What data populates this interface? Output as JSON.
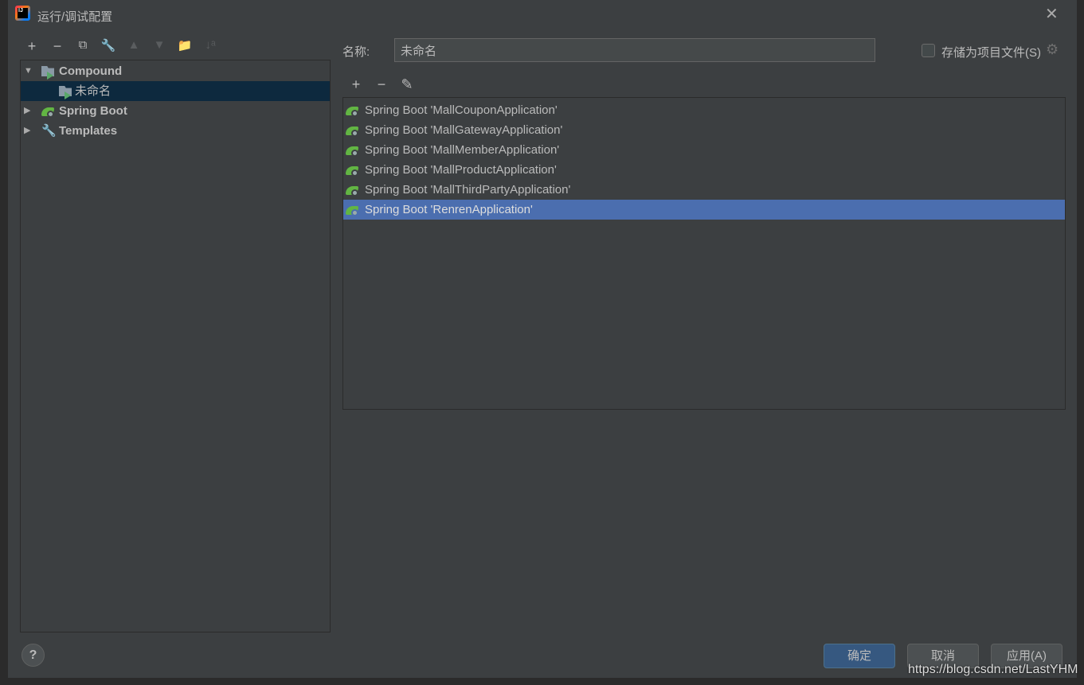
{
  "window": {
    "title": "运行/调试配置",
    "close_icon": "close-icon"
  },
  "left_toolbar": [
    {
      "name": "add-icon",
      "glyph": "+"
    },
    {
      "name": "remove-icon",
      "glyph": "−"
    },
    {
      "name": "copy-icon",
      "glyph": "⧉"
    },
    {
      "name": "wrench-icon",
      "glyph": "🔧"
    },
    {
      "name": "move-up-icon",
      "glyph": "▲"
    },
    {
      "name": "move-down-icon",
      "glyph": "▼"
    },
    {
      "name": "new-folder-icon",
      "glyph": "📁"
    },
    {
      "name": "sort-icon",
      "glyph": "↓ᵃ"
    }
  ],
  "tree": [
    {
      "label": "Compound",
      "expanded": true
    },
    {
      "label": "未命名",
      "selected": true
    },
    {
      "label": "Spring Boot",
      "expanded": false
    },
    {
      "label": "Templates",
      "expanded": false
    }
  ],
  "form": {
    "name_label": "名称:",
    "name_value": "未命名",
    "store_label": "存储为项目文件(S)",
    "store_checked": false
  },
  "list_toolbar": [
    {
      "name": "add-icon",
      "glyph": "+"
    },
    {
      "name": "remove-icon",
      "glyph": "−"
    },
    {
      "name": "edit-icon",
      "glyph": "✎"
    }
  ],
  "configurations": [
    "Spring Boot 'MallCouponApplication'",
    "Spring Boot 'MallGatewayApplication'",
    "Spring Boot 'MallMemberApplication'",
    "Spring Boot 'MallProductApplication'",
    "Spring Boot 'MallThirdPartyApplication'",
    "Spring Boot 'RenrenApplication'"
  ],
  "selected_configuration": 5,
  "buttons": {
    "help": "?",
    "ok": "确定",
    "cancel": "取消",
    "apply": "应用(A)"
  },
  "watermark": "https://blog.csdn.net/LastYHM",
  "colors": {
    "background": "#3c3f41",
    "selection": "#4b6eaf",
    "tree_selection": "#0d293e",
    "primary_button": "#365880"
  }
}
